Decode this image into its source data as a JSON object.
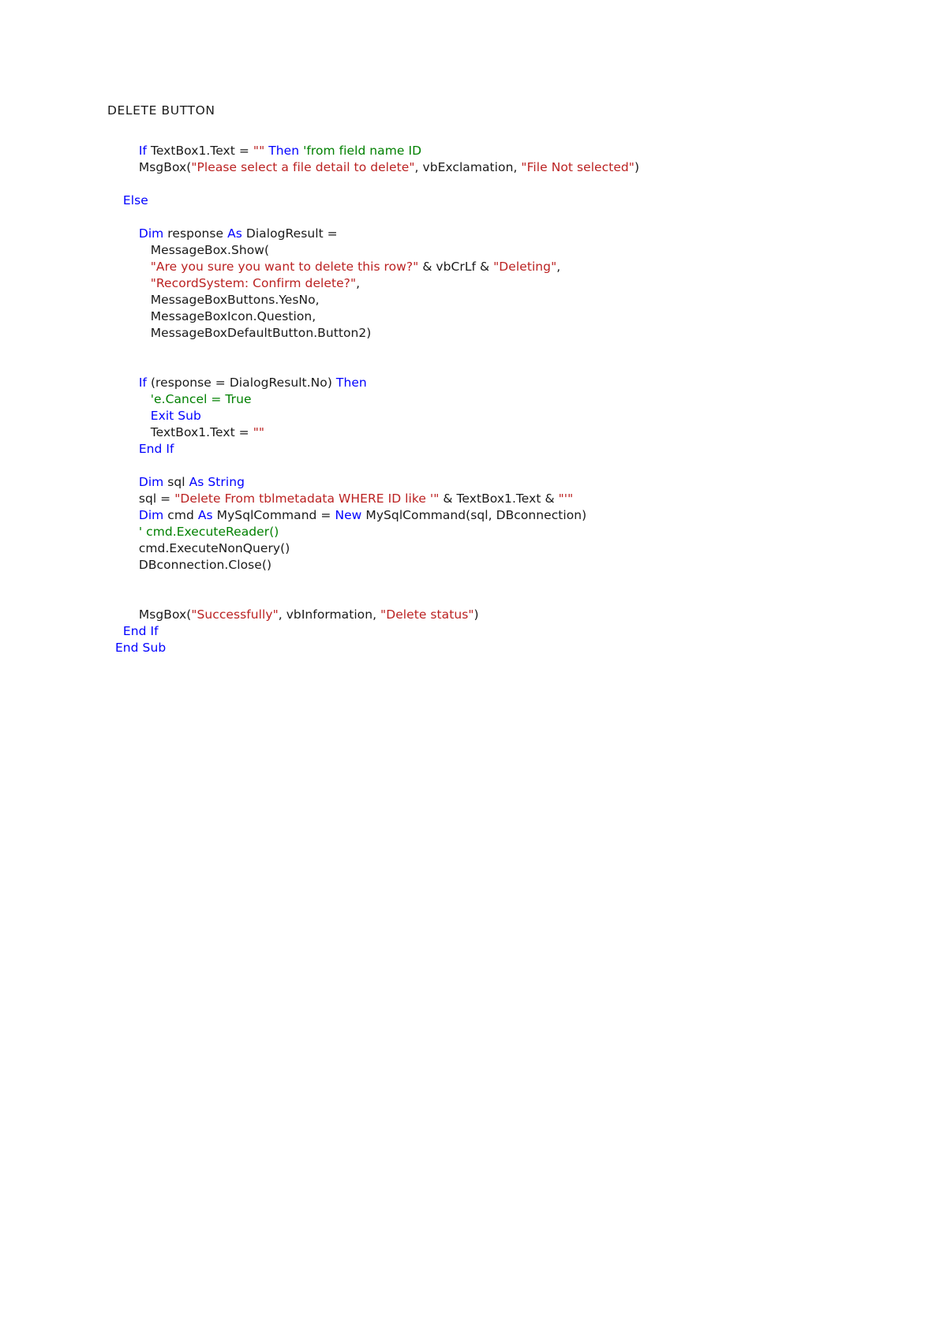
{
  "document": {
    "heading": "DELETE BUTTON",
    "colors": {
      "keyword": "#0000ff",
      "string": "#bb2222",
      "comment": "#008000",
      "plain": "#1a1a1a",
      "page_background": "#ffffff"
    },
    "language": "VB.NET",
    "code_lines": [
      {
        "indent": "        ",
        "tokens": [
          {
            "t": "If ",
            "c": "kw"
          },
          {
            "t": "TextBox1.Text = ",
            "c": "plain"
          },
          {
            "t": "\"\"",
            "c": "str"
          },
          {
            "t": " ",
            "c": "plain"
          },
          {
            "t": "Then",
            "c": "kw"
          },
          {
            "t": " ",
            "c": "plain"
          },
          {
            "t": "'from field name ID",
            "c": "cmt"
          }
        ]
      },
      {
        "indent": "        ",
        "tokens": [
          {
            "t": "MsgBox(",
            "c": "plain"
          },
          {
            "t": "\"Please select a file detail to delete\"",
            "c": "str"
          },
          {
            "t": ", vbExclamation, ",
            "c": "plain"
          },
          {
            "t": "\"File Not selected\"",
            "c": "str"
          },
          {
            "t": ")",
            "c": "plain"
          }
        ]
      },
      {
        "indent": "",
        "tokens": []
      },
      {
        "indent": "    ",
        "tokens": [
          {
            "t": "Else",
            "c": "kw"
          }
        ]
      },
      {
        "indent": "",
        "tokens": []
      },
      {
        "indent": "        ",
        "tokens": [
          {
            "t": "Dim ",
            "c": "kw"
          },
          {
            "t": "response ",
            "c": "plain"
          },
          {
            "t": "As ",
            "c": "kw"
          },
          {
            "t": "DialogResult =",
            "c": "plain"
          }
        ]
      },
      {
        "indent": "           ",
        "tokens": [
          {
            "t": "MessageBox.Show(",
            "c": "plain"
          }
        ]
      },
      {
        "indent": "           ",
        "tokens": [
          {
            "t": "\"Are you sure you want to delete this row?\"",
            "c": "str"
          },
          {
            "t": " & vbCrLf & ",
            "c": "plain"
          },
          {
            "t": "\"Deleting\"",
            "c": "str"
          },
          {
            "t": ",",
            "c": "plain"
          }
        ]
      },
      {
        "indent": "           ",
        "tokens": [
          {
            "t": "\"RecordSystem: Confirm delete?\"",
            "c": "str"
          },
          {
            "t": ",",
            "c": "plain"
          }
        ]
      },
      {
        "indent": "           ",
        "tokens": [
          {
            "t": "MessageBoxButtons.YesNo,",
            "c": "plain"
          }
        ]
      },
      {
        "indent": "           ",
        "tokens": [
          {
            "t": "MessageBoxIcon.Question,",
            "c": "plain"
          }
        ]
      },
      {
        "indent": "           ",
        "tokens": [
          {
            "t": "MessageBoxDefaultButton.Button2)",
            "c": "plain"
          }
        ]
      },
      {
        "indent": "",
        "tokens": []
      },
      {
        "indent": "",
        "tokens": []
      },
      {
        "indent": "        ",
        "tokens": [
          {
            "t": "If ",
            "c": "kw"
          },
          {
            "t": "(response = DialogResult.No) ",
            "c": "plain"
          },
          {
            "t": "Then",
            "c": "kw"
          }
        ]
      },
      {
        "indent": "           ",
        "tokens": [
          {
            "t": "'e.Cancel = True",
            "c": "cmt"
          }
        ]
      },
      {
        "indent": "           ",
        "tokens": [
          {
            "t": "Exit Sub",
            "c": "kw"
          }
        ]
      },
      {
        "indent": "           ",
        "tokens": [
          {
            "t": "TextBox1.Text = ",
            "c": "plain"
          },
          {
            "t": "\"\"",
            "c": "str"
          }
        ]
      },
      {
        "indent": "        ",
        "tokens": [
          {
            "t": "End If",
            "c": "kw"
          }
        ]
      },
      {
        "indent": "",
        "tokens": []
      },
      {
        "indent": "        ",
        "tokens": [
          {
            "t": "Dim ",
            "c": "kw"
          },
          {
            "t": "sql ",
            "c": "plain"
          },
          {
            "t": "As String",
            "c": "kw"
          }
        ]
      },
      {
        "indent": "        ",
        "tokens": [
          {
            "t": "sql = ",
            "c": "plain"
          },
          {
            "t": "\"Delete From tblmetadata WHERE ID like '\"",
            "c": "str"
          },
          {
            "t": " & TextBox1.Text & ",
            "c": "plain"
          },
          {
            "t": "\"'\"",
            "c": "str"
          }
        ]
      },
      {
        "indent": "        ",
        "tokens": [
          {
            "t": "Dim ",
            "c": "kw"
          },
          {
            "t": "cmd ",
            "c": "plain"
          },
          {
            "t": "As ",
            "c": "kw"
          },
          {
            "t": "MySqlCommand = ",
            "c": "plain"
          },
          {
            "t": "New ",
            "c": "kw"
          },
          {
            "t": "MySqlCommand(sql, DBconnection)",
            "c": "plain"
          }
        ]
      },
      {
        "indent": "        ",
        "tokens": [
          {
            "t": "' cmd.ExecuteReader()",
            "c": "cmt"
          }
        ]
      },
      {
        "indent": "        ",
        "tokens": [
          {
            "t": "cmd.ExecuteNonQuery()",
            "c": "plain"
          }
        ]
      },
      {
        "indent": "        ",
        "tokens": [
          {
            "t": "DBconnection.Close()",
            "c": "plain"
          }
        ]
      },
      {
        "indent": "",
        "tokens": []
      },
      {
        "indent": "",
        "tokens": []
      },
      {
        "indent": "        ",
        "tokens": [
          {
            "t": "MsgBox(",
            "c": "plain"
          },
          {
            "t": "\"Successfully\"",
            "c": "str"
          },
          {
            "t": ", vbInformation, ",
            "c": "plain"
          },
          {
            "t": "\"Delete status\"",
            "c": "str"
          },
          {
            "t": ")",
            "c": "plain"
          }
        ]
      },
      {
        "indent": "    ",
        "tokens": [
          {
            "t": "End If",
            "c": "kw"
          }
        ]
      },
      {
        "indent": "  ",
        "tokens": [
          {
            "t": "End Sub",
            "c": "kw"
          }
        ]
      }
    ]
  }
}
